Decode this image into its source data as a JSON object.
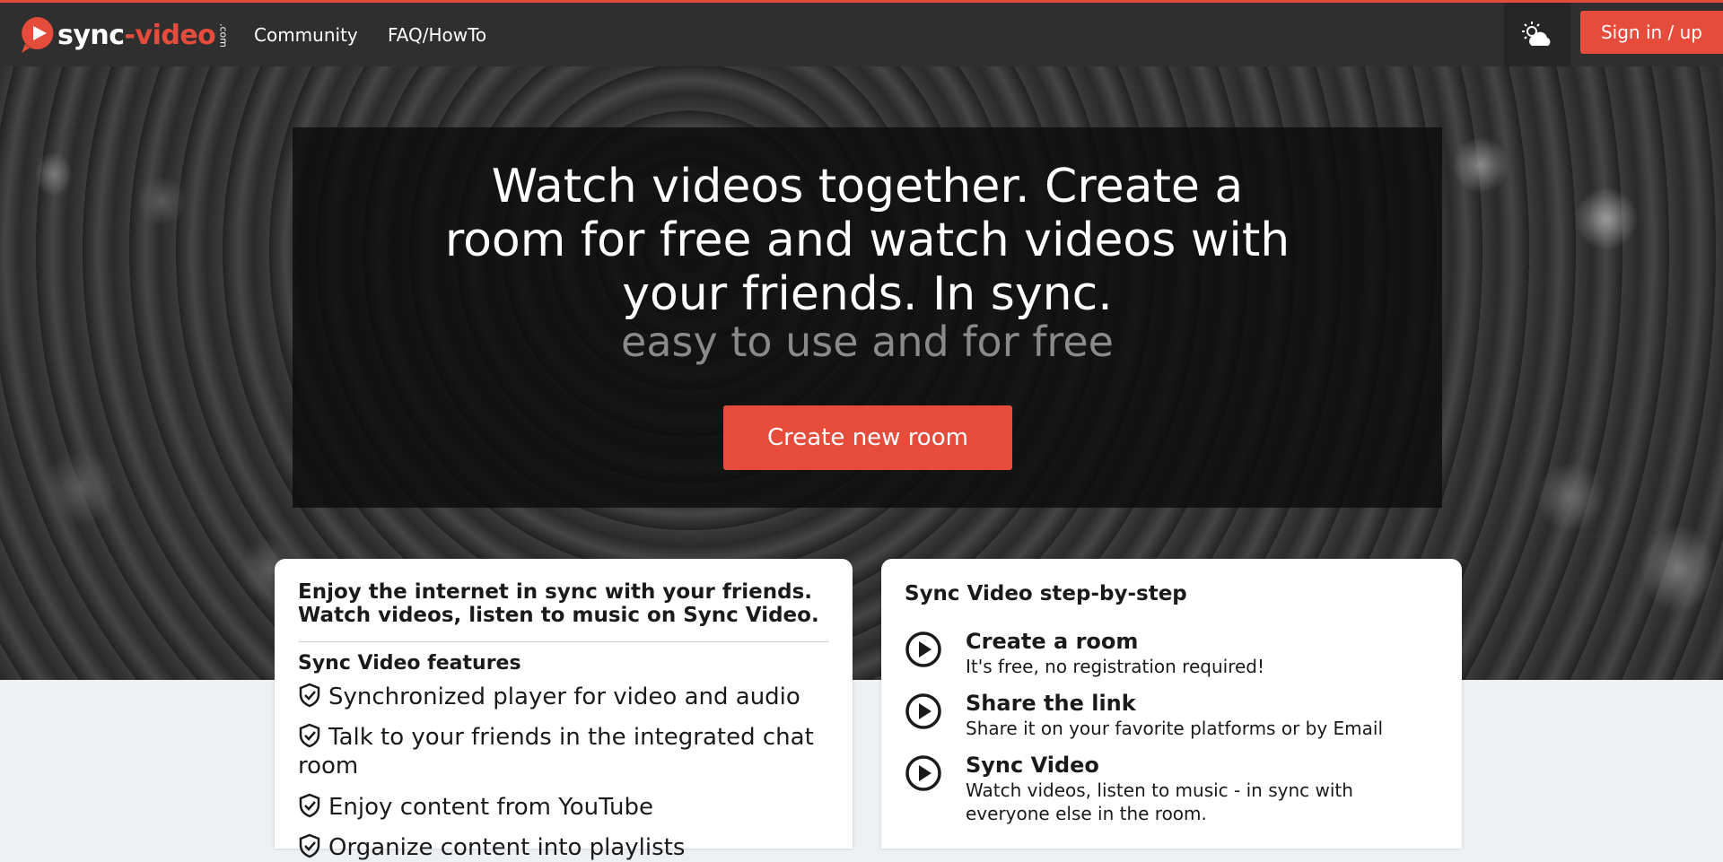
{
  "nav": {
    "logo_part1": "sync",
    "logo_part2": "-video",
    "logo_com": ".com",
    "links": [
      "Community",
      "FAQ/HowTo"
    ],
    "weather_icon": "sun-cloud-icon",
    "signin_label": "Sign in / up"
  },
  "hero": {
    "title_lines": [
      "Watch videos together. Create a",
      "room for free and watch videos with",
      "your friends. In sync."
    ],
    "subtitle": "easy to use and for free",
    "cta_label": "Create new room"
  },
  "left_card": {
    "heading_lines": [
      "Enjoy the internet in sync with your friends.",
      "Watch videos, listen to music on Sync Video."
    ],
    "features_title": "Sync Video features",
    "features": [
      "Synchronized player for video and audio",
      "Talk to your friends in the integrated chat room",
      "Enjoy content from YouTube",
      "Organize content into playlists"
    ],
    "feature_icon": "shield-check-icon"
  },
  "right_card": {
    "heading": "Sync Video step-by-step",
    "step_icon": "play-circle-icon",
    "steps": [
      {
        "title": "Create a room",
        "desc": "It's free, no registration required!"
      },
      {
        "title": "Share the link",
        "desc": "Share it on your favorite platforms or by Email"
      },
      {
        "title": "Sync Video",
        "desc": "Watch videos, listen to music - in sync with everyone else in the room."
      }
    ]
  },
  "colors": {
    "accent": "#e64c3c",
    "navbar": "#2f2f2f",
    "page_bg": "#eef1f4"
  }
}
